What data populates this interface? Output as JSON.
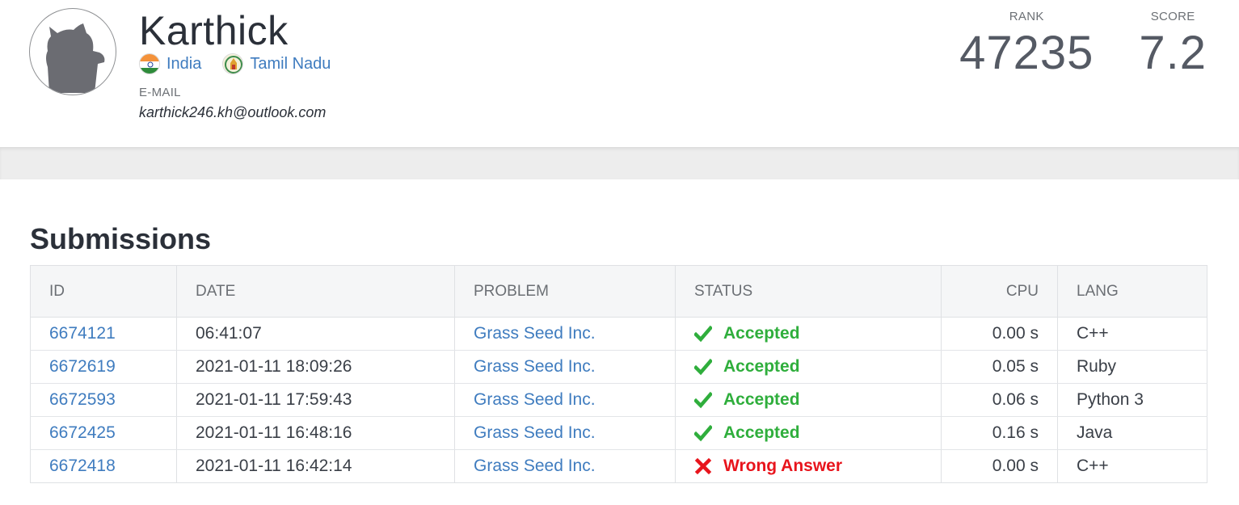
{
  "profile": {
    "name": "Karthick",
    "country": "India",
    "region": "Tamil Nadu",
    "email_label": "E-MAIL",
    "email": "karthick246.kh@outlook.com",
    "avatar_icon": "default-avatar-icon",
    "country_flag_icon": "india-flag-icon",
    "region_flag_icon": "tamil-nadu-emblem-icon"
  },
  "stats": {
    "rank_label": "RANK",
    "rank": "47235",
    "score_label": "SCORE",
    "score": "7.2"
  },
  "submissions": {
    "title": "Submissions",
    "columns": [
      "ID",
      "DATE",
      "PROBLEM",
      "STATUS",
      "CPU",
      "LANG"
    ],
    "rows": [
      {
        "id": "6674121",
        "date": "06:41:07",
        "problem": "Grass Seed Inc.",
        "status": "Accepted",
        "status_icon": "check-icon",
        "cpu": "0.00 s",
        "lang": "C++"
      },
      {
        "id": "6672619",
        "date": "2021-01-11 18:09:26",
        "problem": "Grass Seed Inc.",
        "status": "Accepted",
        "status_icon": "check-icon",
        "cpu": "0.05 s",
        "lang": "Ruby"
      },
      {
        "id": "6672593",
        "date": "2021-01-11 17:59:43",
        "problem": "Grass Seed Inc.",
        "status": "Accepted",
        "status_icon": "check-icon",
        "cpu": "0.06 s",
        "lang": "Python 3"
      },
      {
        "id": "6672425",
        "date": "2021-01-11 16:48:16",
        "problem": "Grass Seed Inc.",
        "status": "Accepted",
        "status_icon": "check-icon",
        "cpu": "0.16 s",
        "lang": "Java"
      },
      {
        "id": "6672418",
        "date": "2021-01-11 16:42:14",
        "problem": "Grass Seed Inc.",
        "status": "Wrong Answer",
        "status_icon": "cross-icon",
        "cpu": "0.00 s",
        "lang": "C++"
      }
    ]
  },
  "colors": {
    "accepted": "#2fae3c",
    "wrong_answer": "#e8141c",
    "link": "#3f7cbf",
    "stat_value": "#555a64"
  }
}
